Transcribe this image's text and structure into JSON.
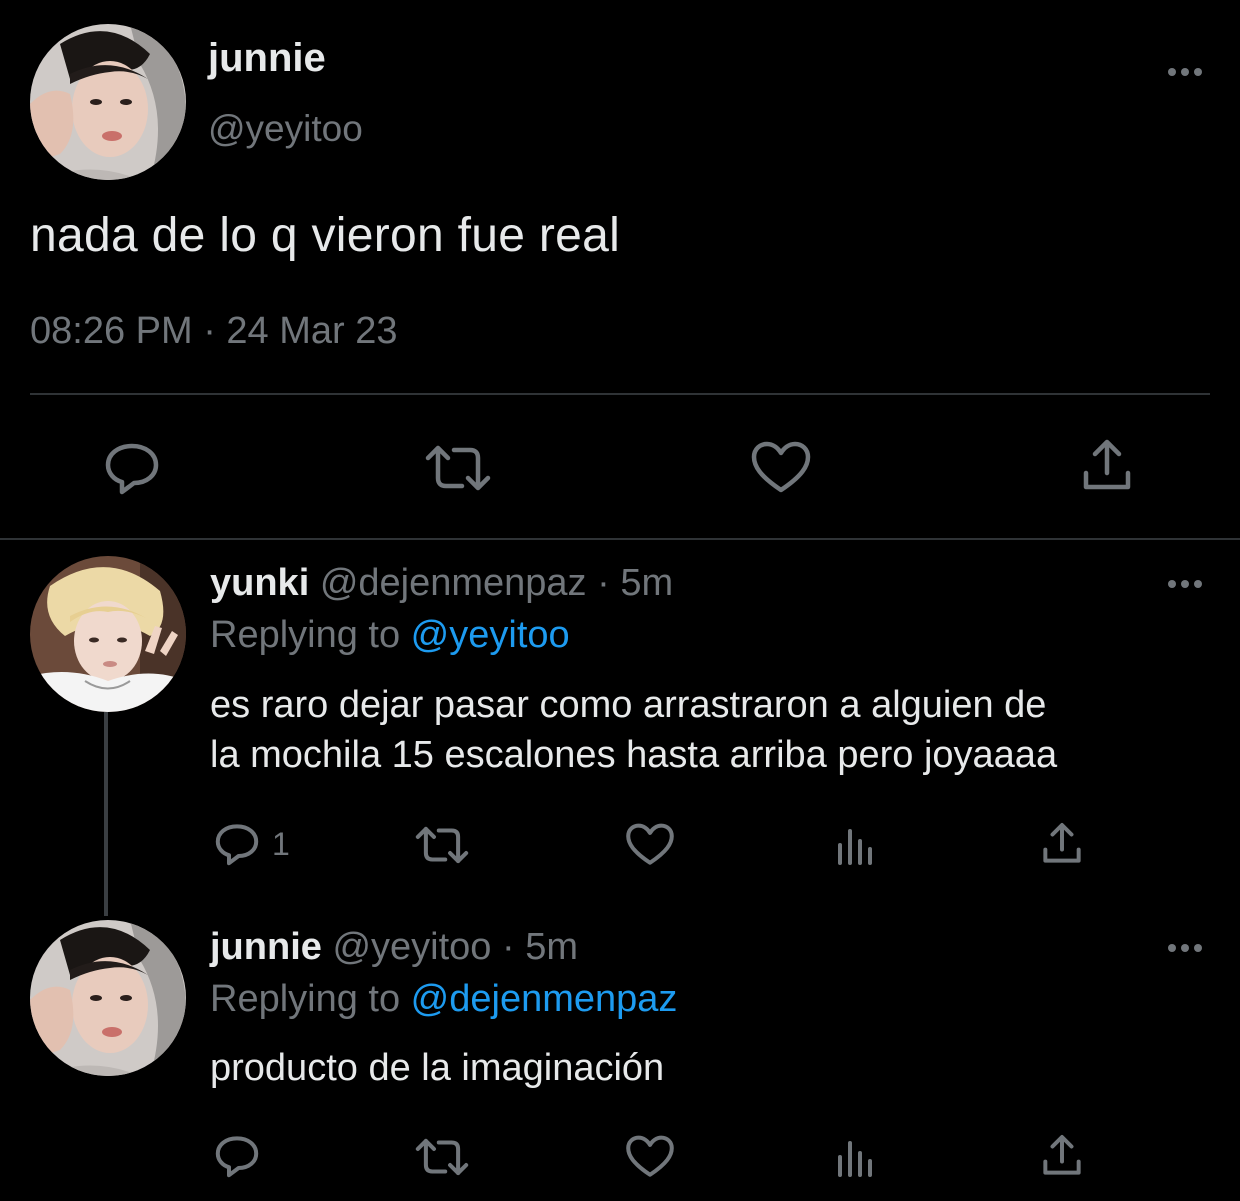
{
  "main_tweet": {
    "name": "junnie",
    "handle": "@yeyitoo",
    "text": "nada de lo q vieron fue real",
    "timestamp": "08:26 PM · 24 Mar 23",
    "actions": [
      "reply-icon",
      "retweet-icon",
      "like-icon",
      "share-icon"
    ]
  },
  "replies": [
    {
      "name": "yunki",
      "handle_time": "@dejenmenpaz · 5m",
      "replying_prefix": "Replying to ",
      "replying_to": "@yeyitoo",
      "text_line1": "es raro dejar pasar como arrastraron a alguien de",
      "text_line2": "la mochila 15 escalones hasta arriba pero joyaaaa",
      "reply_count": "1"
    },
    {
      "name": "junnie",
      "handle_time": "@yeyitoo · 5m",
      "replying_prefix": "Replying to ",
      "replying_to": "@dejenmenpaz",
      "text_line1": "producto de la imaginación",
      "reply_count": ""
    }
  ],
  "colors": {
    "background": "#000000",
    "text": "#e7e9ea",
    "secondary": "#71767b",
    "link": "#1d9bf0",
    "divider": "#2f3336"
  }
}
